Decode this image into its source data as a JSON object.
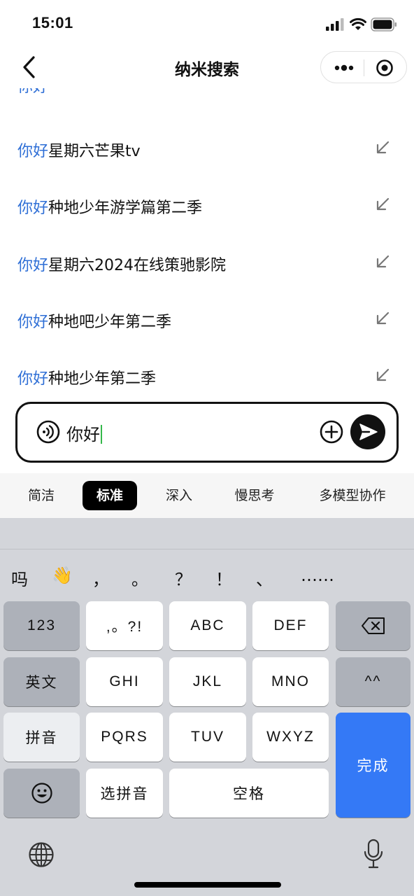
{
  "status_bar": {
    "time": "15:01"
  },
  "nav": {
    "title": "纳米搜索"
  },
  "suggestions": [
    {
      "highlight": "你好",
      "rest": "星期六芒果tv"
    },
    {
      "highlight": "你好",
      "rest": "种地少年游学篇第二季"
    },
    {
      "highlight": "你好",
      "rest": "星期六2024在线策驰影院"
    },
    {
      "highlight": "你好",
      "rest": "种地吧少年第二季"
    },
    {
      "highlight": "你好",
      "rest": "种地少年第二季"
    }
  ],
  "input": {
    "value": "你好"
  },
  "mode_tabs": [
    {
      "label": "简洁"
    },
    {
      "label": "标准",
      "active": true
    },
    {
      "label": "深入"
    },
    {
      "label": "慢思考"
    },
    {
      "label": "多模型协作"
    }
  ],
  "keyboard": {
    "candidates": [
      "吗",
      "👋",
      "，",
      "。",
      "？",
      "！",
      "、",
      "……"
    ],
    "keys": {
      "num": "123",
      "punct": ",。?!",
      "abc": "ABC",
      "def": "DEF",
      "english": "英文",
      "ghi": "GHI",
      "jkl": "JKL",
      "mno": "MNO",
      "emoticon": "^^",
      "pinyin": "拼音",
      "pqrs": "PQRS",
      "tuv": "TUV",
      "wxyz": "WXYZ",
      "done": "完成",
      "select_pinyin": "选拼音",
      "space": "空格"
    }
  },
  "colors": {
    "highlight": "#2f6fd6",
    "done_key": "#3479f6",
    "caret": "#35b84a"
  }
}
